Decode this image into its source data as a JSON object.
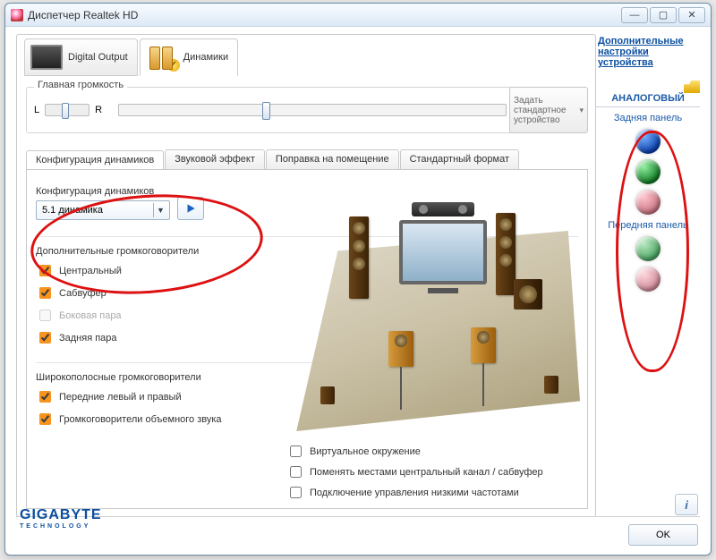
{
  "window": {
    "title": "Диспетчер Realtek HD"
  },
  "links": {
    "advanced": "Дополнительные настройки устройства"
  },
  "deviceTabs": {
    "digital": "Digital Output",
    "speakers": "Динамики"
  },
  "mainVolume": {
    "group": "Главная громкость",
    "L": "L",
    "R": "R"
  },
  "defaultBtn": {
    "line1": "Задать",
    "line2": "стандартное",
    "line3": "устройство"
  },
  "tabs": {
    "config": "Конфигурация динамиков",
    "effect": "Звуковой эффект",
    "room": "Поправка на помещение",
    "format": "Стандартный формат"
  },
  "config": {
    "label": "Конфигурация динамиков",
    "value": "5.1 динамика",
    "extra_label": "Дополнительные громкоговорители",
    "chk_center": "Центральный",
    "chk_sub": "Сабвуфер",
    "chk_side": "Боковая пара",
    "chk_rear": "Задняя пара",
    "wide_label": "Широкополосные громкоговорители",
    "chk_front": "Передние левый и правый",
    "chk_surround": "Громкоговорители объемного звука"
  },
  "roomOpts": {
    "virtual": "Виртуальное окружение",
    "swap": "Поменять местами центральный канал / сабвуфер",
    "bass": "Подключение управления низкими частотами"
  },
  "analog": {
    "title": "АНАЛОГОВЫЙ",
    "rear": "Задняя панель",
    "front": "Передняя панель"
  },
  "brand": {
    "name": "GIGABYTE",
    "tag": "TECHNOLOGY"
  },
  "buttons": {
    "ok": "OK"
  }
}
